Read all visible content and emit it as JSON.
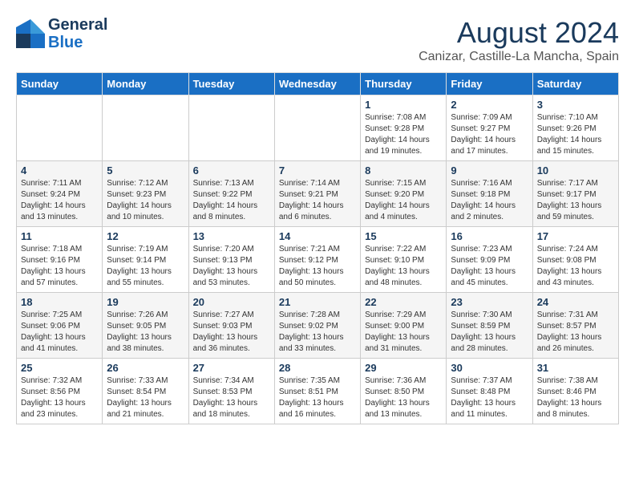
{
  "header": {
    "logo_line1": "General",
    "logo_line2": "Blue",
    "month": "August 2024",
    "location": "Canizar, Castille-La Mancha, Spain"
  },
  "days_of_week": [
    "Sunday",
    "Monday",
    "Tuesday",
    "Wednesday",
    "Thursday",
    "Friday",
    "Saturday"
  ],
  "weeks": [
    [
      {
        "date": "",
        "info": ""
      },
      {
        "date": "",
        "info": ""
      },
      {
        "date": "",
        "info": ""
      },
      {
        "date": "",
        "info": ""
      },
      {
        "date": "1",
        "info": "Sunrise: 7:08 AM\nSunset: 9:28 PM\nDaylight: 14 hours\nand 19 minutes."
      },
      {
        "date": "2",
        "info": "Sunrise: 7:09 AM\nSunset: 9:27 PM\nDaylight: 14 hours\nand 17 minutes."
      },
      {
        "date": "3",
        "info": "Sunrise: 7:10 AM\nSunset: 9:26 PM\nDaylight: 14 hours\nand 15 minutes."
      }
    ],
    [
      {
        "date": "4",
        "info": "Sunrise: 7:11 AM\nSunset: 9:24 PM\nDaylight: 14 hours\nand 13 minutes."
      },
      {
        "date": "5",
        "info": "Sunrise: 7:12 AM\nSunset: 9:23 PM\nDaylight: 14 hours\nand 10 minutes."
      },
      {
        "date": "6",
        "info": "Sunrise: 7:13 AM\nSunset: 9:22 PM\nDaylight: 14 hours\nand 8 minutes."
      },
      {
        "date": "7",
        "info": "Sunrise: 7:14 AM\nSunset: 9:21 PM\nDaylight: 14 hours\nand 6 minutes."
      },
      {
        "date": "8",
        "info": "Sunrise: 7:15 AM\nSunset: 9:20 PM\nDaylight: 14 hours\nand 4 minutes."
      },
      {
        "date": "9",
        "info": "Sunrise: 7:16 AM\nSunset: 9:18 PM\nDaylight: 14 hours\nand 2 minutes."
      },
      {
        "date": "10",
        "info": "Sunrise: 7:17 AM\nSunset: 9:17 PM\nDaylight: 13 hours\nand 59 minutes."
      }
    ],
    [
      {
        "date": "11",
        "info": "Sunrise: 7:18 AM\nSunset: 9:16 PM\nDaylight: 13 hours\nand 57 minutes."
      },
      {
        "date": "12",
        "info": "Sunrise: 7:19 AM\nSunset: 9:14 PM\nDaylight: 13 hours\nand 55 minutes."
      },
      {
        "date": "13",
        "info": "Sunrise: 7:20 AM\nSunset: 9:13 PM\nDaylight: 13 hours\nand 53 minutes."
      },
      {
        "date": "14",
        "info": "Sunrise: 7:21 AM\nSunset: 9:12 PM\nDaylight: 13 hours\nand 50 minutes."
      },
      {
        "date": "15",
        "info": "Sunrise: 7:22 AM\nSunset: 9:10 PM\nDaylight: 13 hours\nand 48 minutes."
      },
      {
        "date": "16",
        "info": "Sunrise: 7:23 AM\nSunset: 9:09 PM\nDaylight: 13 hours\nand 45 minutes."
      },
      {
        "date": "17",
        "info": "Sunrise: 7:24 AM\nSunset: 9:08 PM\nDaylight: 13 hours\nand 43 minutes."
      }
    ],
    [
      {
        "date": "18",
        "info": "Sunrise: 7:25 AM\nSunset: 9:06 PM\nDaylight: 13 hours\nand 41 minutes."
      },
      {
        "date": "19",
        "info": "Sunrise: 7:26 AM\nSunset: 9:05 PM\nDaylight: 13 hours\nand 38 minutes."
      },
      {
        "date": "20",
        "info": "Sunrise: 7:27 AM\nSunset: 9:03 PM\nDaylight: 13 hours\nand 36 minutes."
      },
      {
        "date": "21",
        "info": "Sunrise: 7:28 AM\nSunset: 9:02 PM\nDaylight: 13 hours\nand 33 minutes."
      },
      {
        "date": "22",
        "info": "Sunrise: 7:29 AM\nSunset: 9:00 PM\nDaylight: 13 hours\nand 31 minutes."
      },
      {
        "date": "23",
        "info": "Sunrise: 7:30 AM\nSunset: 8:59 PM\nDaylight: 13 hours\nand 28 minutes."
      },
      {
        "date": "24",
        "info": "Sunrise: 7:31 AM\nSunset: 8:57 PM\nDaylight: 13 hours\nand 26 minutes."
      }
    ],
    [
      {
        "date": "25",
        "info": "Sunrise: 7:32 AM\nSunset: 8:56 PM\nDaylight: 13 hours\nand 23 minutes."
      },
      {
        "date": "26",
        "info": "Sunrise: 7:33 AM\nSunset: 8:54 PM\nDaylight: 13 hours\nand 21 minutes."
      },
      {
        "date": "27",
        "info": "Sunrise: 7:34 AM\nSunset: 8:53 PM\nDaylight: 13 hours\nand 18 minutes."
      },
      {
        "date": "28",
        "info": "Sunrise: 7:35 AM\nSunset: 8:51 PM\nDaylight: 13 hours\nand 16 minutes."
      },
      {
        "date": "29",
        "info": "Sunrise: 7:36 AM\nSunset: 8:50 PM\nDaylight: 13 hours\nand 13 minutes."
      },
      {
        "date": "30",
        "info": "Sunrise: 7:37 AM\nSunset: 8:48 PM\nDaylight: 13 hours\nand 11 minutes."
      },
      {
        "date": "31",
        "info": "Sunrise: 7:38 AM\nSunset: 8:46 PM\nDaylight: 13 hours\nand 8 minutes."
      }
    ]
  ]
}
